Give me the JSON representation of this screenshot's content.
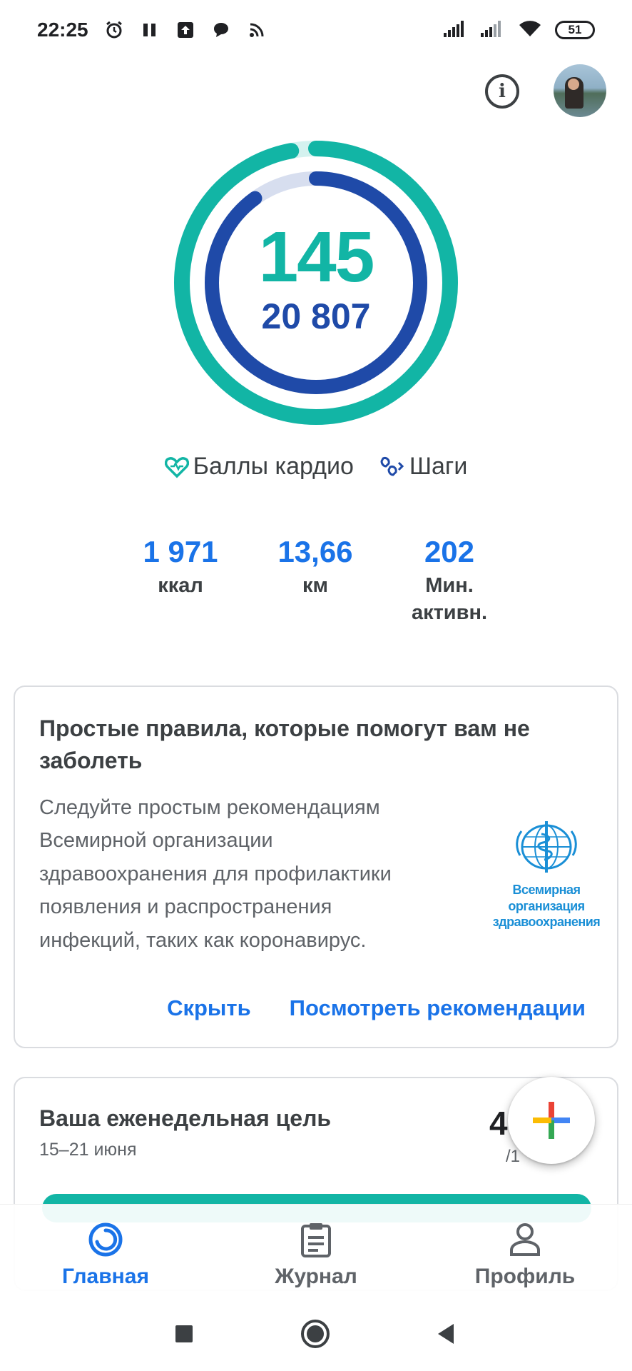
{
  "status_bar": {
    "time": "22:25",
    "battery": "51",
    "left_icons": [
      "alarm-icon",
      "pause-icon",
      "upload-icon",
      "chat-icon",
      "cast-icon"
    ],
    "right_icons": [
      "signal-icon",
      "signal-icon",
      "wifi-icon",
      "battery-icon"
    ]
  },
  "top_bar": {
    "info_icon": "info-icon",
    "avatar": "profile-avatar"
  },
  "ring": {
    "cardio_points": "145",
    "steps": "20 807",
    "cardio_color": "#12b5a5",
    "steps_color": "#1f4aa8",
    "cardio_progress": 0.97,
    "steps_progress": 0.9
  },
  "legend": {
    "cardio_label": "Баллы кардио",
    "steps_label": "Шаги"
  },
  "stats": [
    {
      "value": "1 971",
      "label": "ккал"
    },
    {
      "value": "13,66",
      "label": "км"
    },
    {
      "value": "202",
      "label_line1": "Мин.",
      "label_line2": "активн."
    }
  ],
  "who_card": {
    "title": "Простые правила, которые помогут вам не заболеть",
    "body": "Следуйте простым рекомендациям Всемирной организации здравоохранения для профилактики появления и распространения инфекций, таких как коронавирус.",
    "logo_line1": "Всемирная",
    "logo_line2": "организация",
    "logo_line3": "здравоохранения",
    "hide_label": "Скрыть",
    "view_label": "Посмотреть рекомендации"
  },
  "goal_card": {
    "title": "Ваша еженедельная цель",
    "dates": "15–21 июня",
    "value": "4",
    "sub": "/1"
  },
  "bottom_nav": {
    "home": "Главная",
    "journal": "Журнал",
    "profile": "Профиль"
  },
  "colors": {
    "accent": "#1a73e8",
    "teal": "#12b5a5",
    "navy": "#1f4aa8"
  }
}
